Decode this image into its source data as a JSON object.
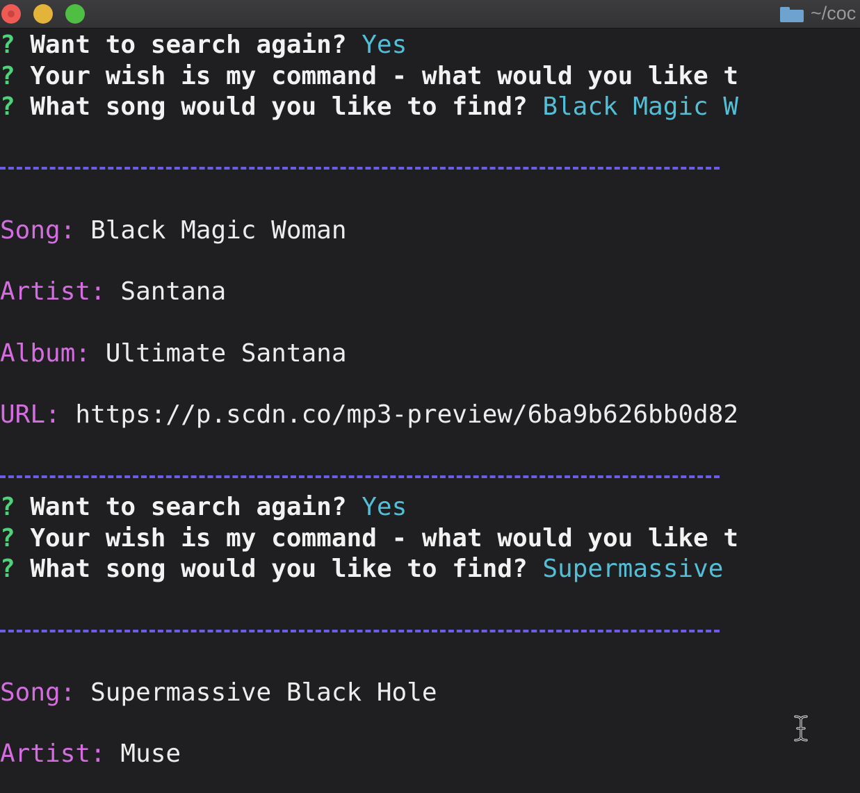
{
  "titlebar": {
    "path": "~/coc",
    "folder_icon": "folder-icon"
  },
  "colors": {
    "background": "#1f1f21",
    "question_mark": "#4fd27a",
    "answer": "#52bfd6",
    "label": "#d46ee0",
    "separator": "#6c5ce8"
  },
  "terminal": {
    "block1": {
      "q1": {
        "mark": "?",
        "prompt": "Want to search again?",
        "answer": "Yes"
      },
      "q2": {
        "mark": "?",
        "prompt": "Your wish is my command - what would you like t"
      },
      "q3": {
        "mark": "?",
        "prompt": "What song would you like to find?",
        "answer": "Black Magic W"
      }
    },
    "result1": {
      "song_label": "Song:",
      "song": "Black Magic Woman",
      "artist_label": "Artist:",
      "artist": "Santana",
      "album_label": "Album:",
      "album": "Ultimate Santana",
      "url_label": "URL:",
      "url": "https://p.scdn.co/mp3-preview/6ba9b626bb0d82"
    },
    "block2": {
      "q1": {
        "mark": "?",
        "prompt": "Want to search again?",
        "answer": "Yes"
      },
      "q2": {
        "mark": "?",
        "prompt": "Your wish is my command - what would you like t"
      },
      "q3": {
        "mark": "?",
        "prompt": "What song would you like to find?",
        "answer": "Supermassive"
      }
    },
    "result2": {
      "song_label": "Song:",
      "song": "Supermassive Black Hole",
      "artist_label": "Artist:",
      "artist": "Muse"
    }
  }
}
